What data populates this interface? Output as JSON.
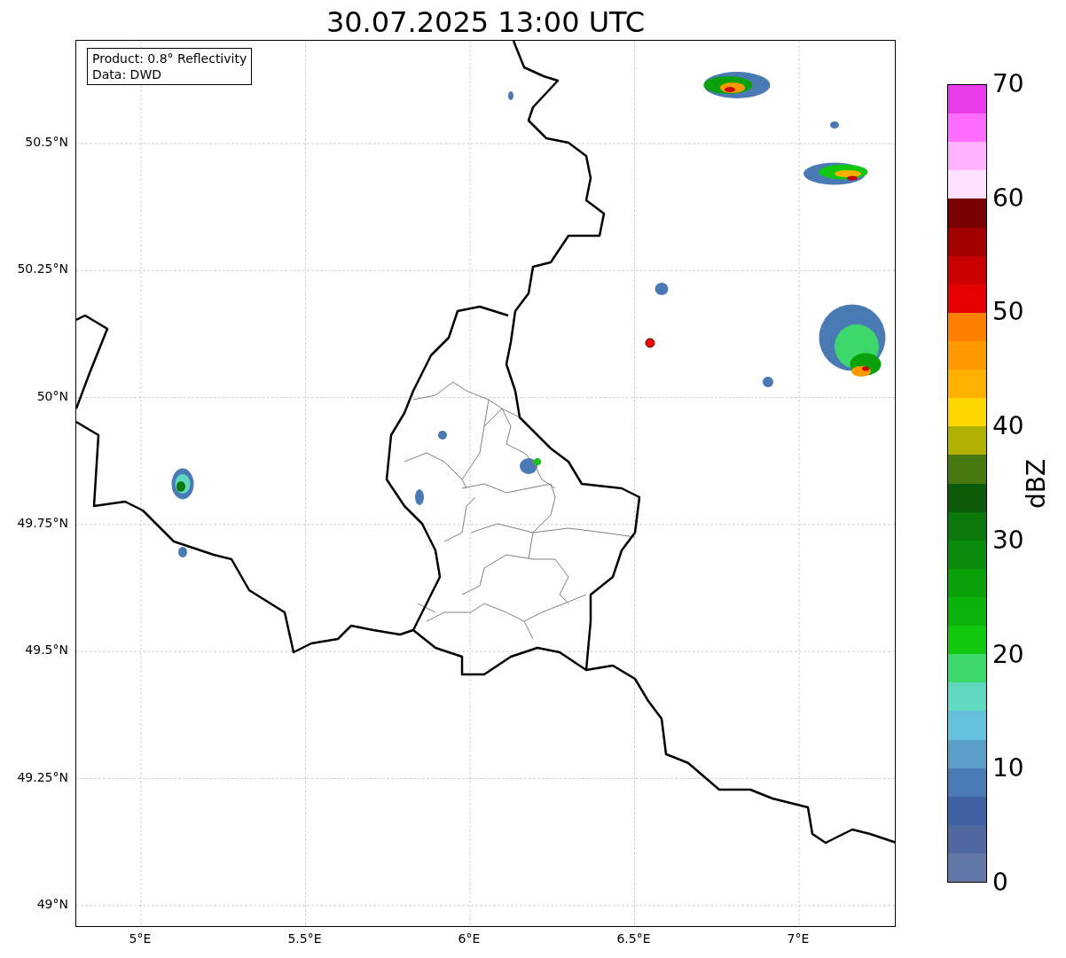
{
  "title": "30.07.2025 13:00 UTC",
  "info_box": {
    "lines": [
      "Product: 0.8° Reflectivity",
      "Data: DWD"
    ]
  },
  "y_ticks": [
    "50.5°N",
    "50.25°N",
    "50°N",
    "49.75°N",
    "49.5°N",
    "49.25°N",
    "49°N"
  ],
  "x_ticks": [
    "5°E",
    "5.5°E",
    "6°E",
    "6.5°E",
    "7°E"
  ],
  "colorbar": {
    "label": "dBZ",
    "ticks": [
      "70",
      "60",
      "50",
      "40",
      "30",
      "20",
      "10",
      "0"
    ],
    "segments": [
      {
        "color": "#e83ce8"
      },
      {
        "color": "#ff6bff"
      },
      {
        "color": "#ffb3ff"
      },
      {
        "color": "#ffe0ff"
      },
      {
        "color": "#780000"
      },
      {
        "color": "#a00000"
      },
      {
        "color": "#c80000"
      },
      {
        "color": "#e60000"
      },
      {
        "color": "#ff7f00"
      },
      {
        "color": "#ff9900"
      },
      {
        "color": "#ffb000"
      },
      {
        "color": "#ffd700"
      },
      {
        "color": "#b0b000"
      },
      {
        "color": "#467810"
      },
      {
        "color": "#0a5a0a"
      },
      {
        "color": "#0a780a"
      },
      {
        "color": "#0a8c0a"
      },
      {
        "color": "#0aa00a"
      },
      {
        "color": "#0ab40a"
      },
      {
        "color": "#10c810"
      },
      {
        "color": "#3cd86c"
      },
      {
        "color": "#60d8c0"
      },
      {
        "color": "#64c0dc"
      },
      {
        "color": "#5a9fc8"
      },
      {
        "color": "#4a7ab4"
      },
      {
        "color": "#4060a4"
      },
      {
        "color": "#5068a0"
      },
      {
        "color": "#6478a8"
      }
    ]
  }
}
